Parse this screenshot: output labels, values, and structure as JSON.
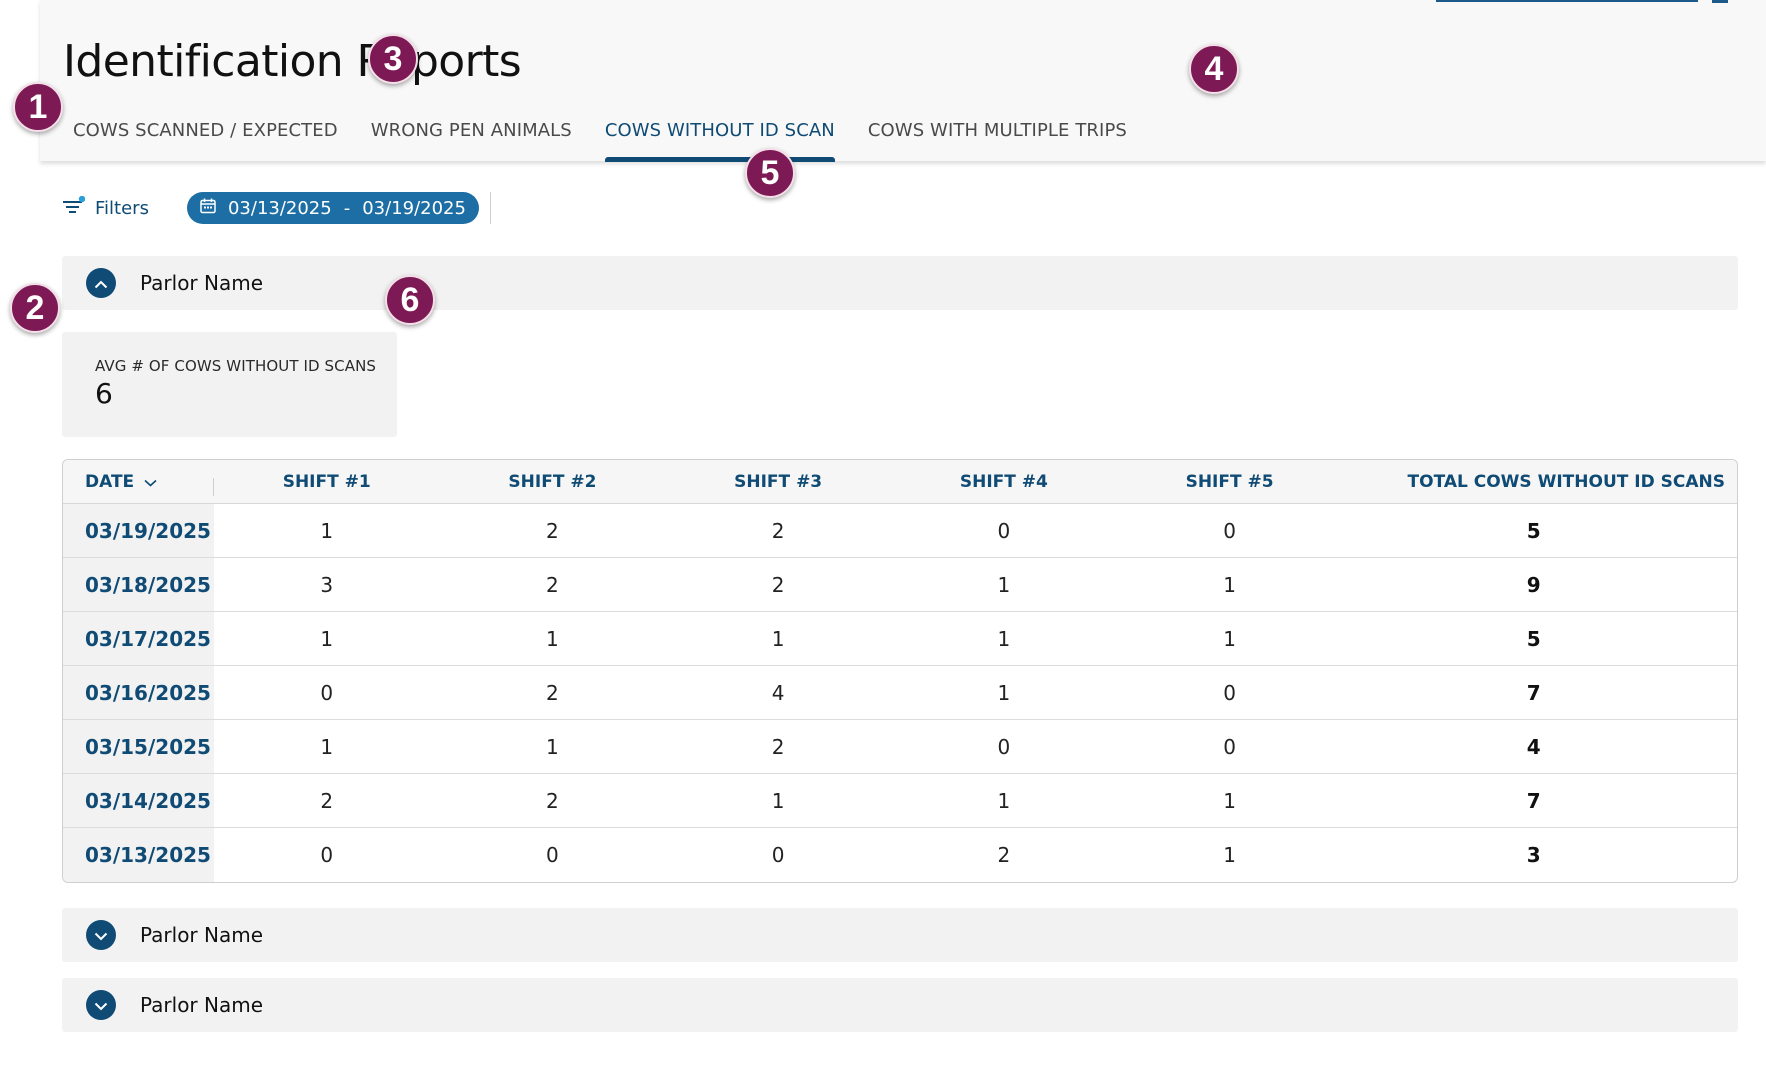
{
  "header": {
    "title": "Identification Reports"
  },
  "tabs": [
    {
      "label": "COWS SCANNED / EXPECTED",
      "active": false
    },
    {
      "label": "WRONG PEN ANIMALS",
      "active": false
    },
    {
      "label": "COWS WITHOUT ID SCAN",
      "active": true
    },
    {
      "label": "COWS WITH MULTIPLE TRIPS",
      "active": false
    }
  ],
  "filters": {
    "label": "Filters",
    "date_start": "03/13/2025",
    "date_separator": "-",
    "date_end": "03/19/2025"
  },
  "sections": [
    {
      "title": "Parlor Name",
      "expanded": true
    },
    {
      "title": "Parlor Name",
      "expanded": false
    },
    {
      "title": "Parlor Name",
      "expanded": false
    }
  ],
  "stat": {
    "label": "AVG # OF COWS WITHOUT ID SCANS",
    "value": "6"
  },
  "table": {
    "columns": [
      "DATE",
      "SHIFT #1",
      "SHIFT #2",
      "SHIFT #3",
      "SHIFT #4",
      "SHIFT #5",
      "TOTAL COWS WITHOUT ID SCANS"
    ],
    "rows": [
      [
        "03/19/2025",
        "1",
        "2",
        "2",
        "0",
        "0",
        "5"
      ],
      [
        "03/18/2025",
        "3",
        "2",
        "2",
        "1",
        "1",
        "9"
      ],
      [
        "03/17/2025",
        "1",
        "1",
        "1",
        "1",
        "1",
        "5"
      ],
      [
        "03/16/2025",
        "0",
        "2",
        "4",
        "1",
        "0",
        "7"
      ],
      [
        "03/15/2025",
        "1",
        "1",
        "2",
        "0",
        "0",
        "4"
      ],
      [
        "03/14/2025",
        "2",
        "2",
        "1",
        "1",
        "1",
        "7"
      ],
      [
        "03/13/2025",
        "0",
        "0",
        "0",
        "2",
        "1",
        "3"
      ]
    ]
  },
  "annotations": [
    "1",
    "2",
    "3",
    "4",
    "5",
    "6"
  ],
  "colors": {
    "primary": "#0f4b74",
    "chip": "#1c6ea4",
    "badge": "#7d1a55",
    "filter_dot": "#2a9fd8"
  },
  "icons": {
    "filters": "filter-lines-icon",
    "calendar": "calendar-icon",
    "collapse": "chevron-up-icon",
    "expand": "chevron-down-icon",
    "sort": "sort-chevron-down-icon"
  }
}
